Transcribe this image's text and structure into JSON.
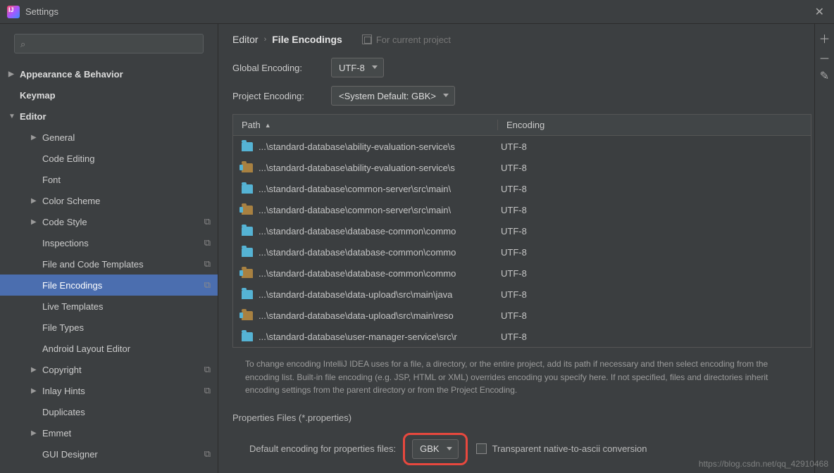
{
  "titlebar": {
    "title": "Settings"
  },
  "search": {
    "placeholder": ""
  },
  "sidebar": {
    "items": [
      {
        "label": "Appearance & Behavior",
        "level": 1,
        "arrow": "▶"
      },
      {
        "label": "Keymap",
        "level": 1,
        "arrow": ""
      },
      {
        "label": "Editor",
        "level": 1,
        "arrow": "▼"
      },
      {
        "label": "General",
        "level": 2,
        "arrow": "▶"
      },
      {
        "label": "Code Editing",
        "level": 2,
        "arrow": ""
      },
      {
        "label": "Font",
        "level": 2,
        "arrow": ""
      },
      {
        "label": "Color Scheme",
        "level": 2,
        "arrow": "▶"
      },
      {
        "label": "Code Style",
        "level": 2,
        "arrow": "▶",
        "copy": true
      },
      {
        "label": "Inspections",
        "level": 2,
        "arrow": "",
        "copy": true
      },
      {
        "label": "File and Code Templates",
        "level": 2,
        "arrow": "",
        "copy": true
      },
      {
        "label": "File Encodings",
        "level": 2,
        "arrow": "",
        "copy": true,
        "selected": true
      },
      {
        "label": "Live Templates",
        "level": 2,
        "arrow": ""
      },
      {
        "label": "File Types",
        "level": 2,
        "arrow": ""
      },
      {
        "label": "Android Layout Editor",
        "level": 2,
        "arrow": ""
      },
      {
        "label": "Copyright",
        "level": 2,
        "arrow": "▶",
        "copy": true
      },
      {
        "label": "Inlay Hints",
        "level": 2,
        "arrow": "▶",
        "copy": true
      },
      {
        "label": "Duplicates",
        "level": 2,
        "arrow": ""
      },
      {
        "label": "Emmet",
        "level": 2,
        "arrow": "▶"
      },
      {
        "label": "GUI Designer",
        "level": 2,
        "arrow": "",
        "copy": true
      }
    ]
  },
  "breadcrumb": {
    "root": "Editor",
    "leaf": "File Encodings",
    "scope": "For current project"
  },
  "settings": {
    "global_label": "Global Encoding:",
    "global_value": "UTF-8",
    "project_label": "Project Encoding:",
    "project_value": "<System Default: GBK>"
  },
  "table": {
    "col_path": "Path",
    "col_enc": "Encoding",
    "rows": [
      {
        "path": "...\\standard-database\\ability-evaluation-service\\s",
        "enc": "UTF-8",
        "alt": false
      },
      {
        "path": "...\\standard-database\\ability-evaluation-service\\s",
        "enc": "UTF-8",
        "alt": true
      },
      {
        "path": "...\\standard-database\\common-server\\src\\main\\",
        "enc": "UTF-8",
        "alt": false
      },
      {
        "path": "...\\standard-database\\common-server\\src\\main\\",
        "enc": "UTF-8",
        "alt": true
      },
      {
        "path": "...\\standard-database\\database-common\\commo",
        "enc": "UTF-8",
        "alt": false
      },
      {
        "path": "...\\standard-database\\database-common\\commo",
        "enc": "UTF-8",
        "alt": false
      },
      {
        "path": "...\\standard-database\\database-common\\commo",
        "enc": "UTF-8",
        "alt": true
      },
      {
        "path": "...\\standard-database\\data-upload\\src\\main\\java",
        "enc": "UTF-8",
        "alt": false
      },
      {
        "path": "...\\standard-database\\data-upload\\src\\main\\reso",
        "enc": "UTF-8",
        "alt": true
      },
      {
        "path": "...\\standard-database\\user-manager-service\\src\\r",
        "enc": "UTF-8",
        "alt": false
      }
    ]
  },
  "hint": "To change encoding IntelliJ IDEA uses for a file, a directory, or the entire project, add its path if necessary and then select encoding from the encoding list. Built-in file encoding (e.g. JSP, HTML or XML) overrides encoding you specify here. If not specified, files and directories inherit encoding settings from the parent directory or from the Project Encoding.",
  "properties": {
    "section": "Properties Files (*.properties)",
    "label": "Default encoding for properties files:",
    "value": "GBK",
    "checkbox_label": "Transparent native-to-ascii conversion"
  },
  "watermark": "https://blog.csdn.net/qq_42910468"
}
